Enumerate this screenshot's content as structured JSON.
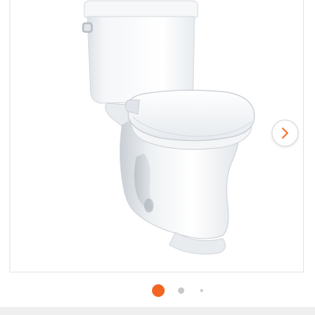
{
  "gallery": {
    "image_icon": "toilet-product-photo",
    "image_count": 3,
    "active_index": 1,
    "next_icon": "chevron-right-icon"
  },
  "colors": {
    "accent": "#f26522",
    "dot_inactive": "#c8c8c8",
    "dot_small": "#d0d0d0",
    "chevron": "#f26522",
    "frame_border": "#e6e6e6"
  }
}
